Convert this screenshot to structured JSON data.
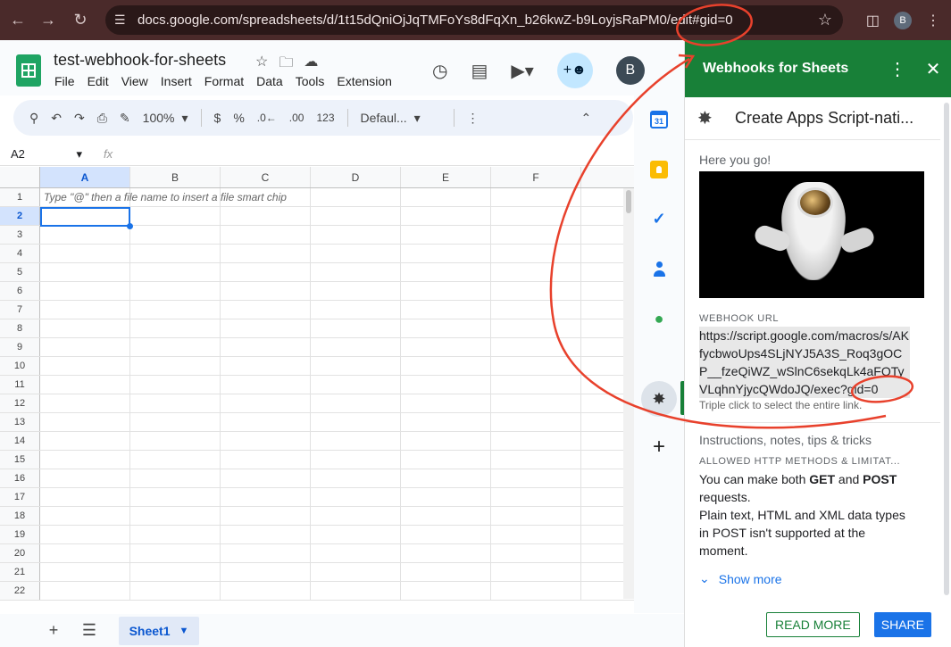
{
  "browser": {
    "url": "docs.google.com/spreadsheets/d/1t15dQniOjJqTMFoYs8dFqXn_b26kwZ-b9LoyjsRaPM0/edit#gid=0",
    "profile_initial": "B"
  },
  "sheets": {
    "title": "test-webhook-for-sheets",
    "menu": [
      "File",
      "Edit",
      "View",
      "Insert",
      "Format",
      "Data",
      "Tools",
      "Extension"
    ],
    "avatar_initial": "B",
    "toolbar": {
      "zoom": "100%",
      "currency": "$",
      "percent": "%",
      "decrease_decimal": ".0←",
      "increase_decimal": ".00",
      "number_format": "123",
      "font": "Defaul..."
    },
    "name_box": "A2",
    "fx": "fx",
    "columns": [
      "A",
      "B",
      "C",
      "D",
      "E",
      "F"
    ],
    "rows": [
      "1",
      "2",
      "3",
      "4",
      "5",
      "6",
      "7",
      "8",
      "9",
      "10",
      "11",
      "12",
      "13",
      "14",
      "15",
      "16",
      "17",
      "18",
      "19",
      "20",
      "21",
      "22"
    ],
    "hint": "Type \"@\" then a file name to insert a file smart chip",
    "sheet_tab": "Sheet1"
  },
  "panel": {
    "header_title": "Webhooks for Sheets",
    "card_title": "Create Apps Script-nati...",
    "here": "Here you go!",
    "webhook_label": "WEBHOOK URL",
    "webhook_url": "https://script.google.com/macros/s/AKfycbwoUps4SLjNYJ5A3S_Roq3gOCP__fzeQiWZ_wSlnC6sekqLk4aFOTyVLqhnYjycQWdoJQ/exec?gid=0",
    "triple_click": "Triple click to select the entire link.",
    "instructions": "Instructions, notes, tips & tricks",
    "allowed_label": "ALLOWED HTTP METHODS & LIMITAT...",
    "text_1a": "You can make both ",
    "text_get": "GET",
    "text_and": " and ",
    "text_post": "POST",
    "text_1b": " requests.",
    "text_2": "Plain text, HTML and XML data types in POST isn't supported at the moment.",
    "show_more": "Show more",
    "read_more": "READ MORE",
    "share": "SHARE"
  },
  "colors": {
    "accent_green": "#188038",
    "link_blue": "#1a73e8",
    "annotation_red": "#e8412c"
  }
}
